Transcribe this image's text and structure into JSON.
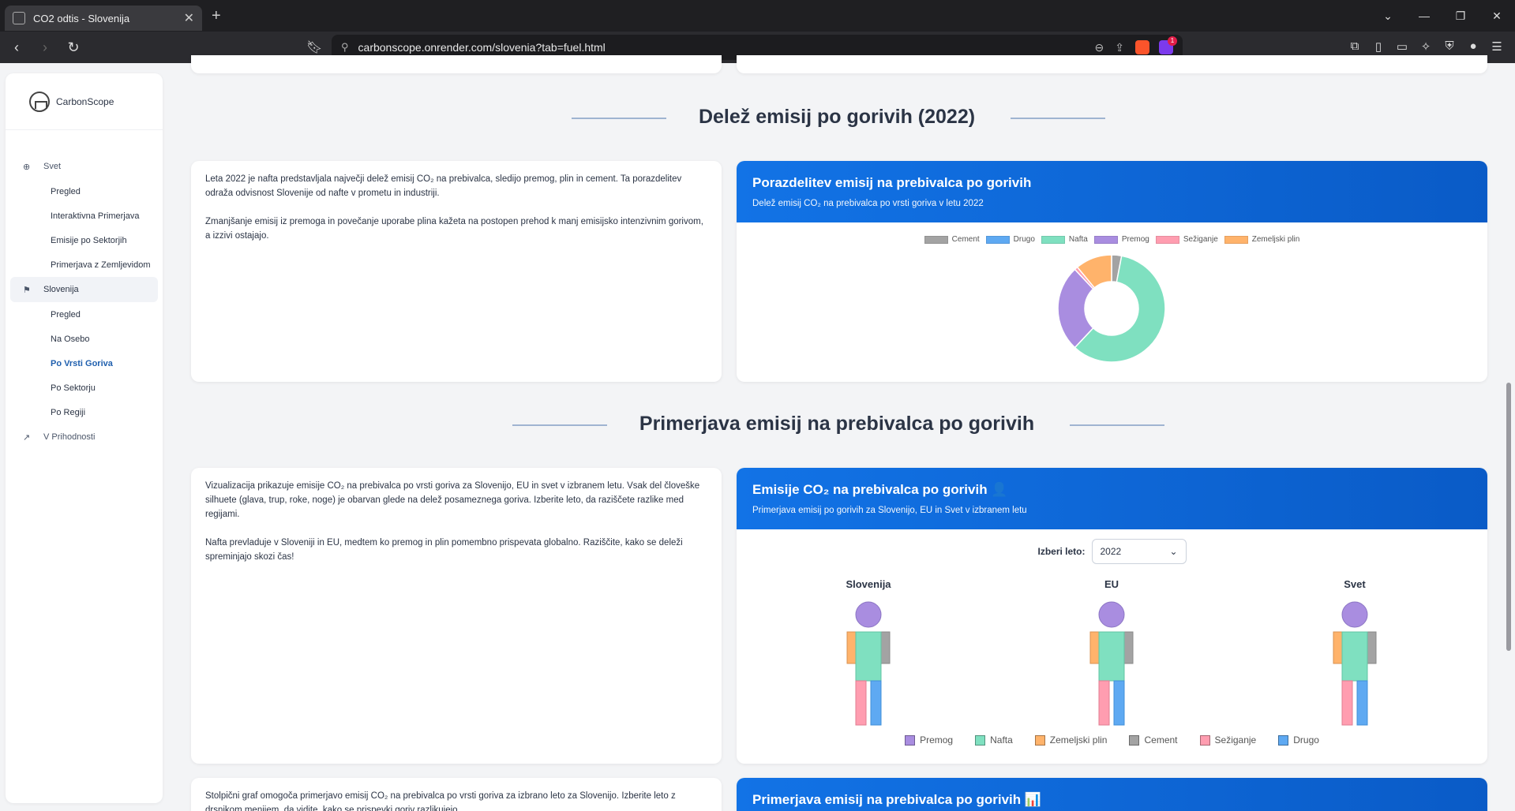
{
  "browser": {
    "tab_title": "CO2 odtis - Slovenija",
    "url": "carbonscope.onrender.com/slovenia?tab=fuel.html",
    "ext_badge": "1"
  },
  "sidebar": {
    "brand": "CarbonScope",
    "groups": [
      {
        "label": "Svet",
        "icon": "globe-icon",
        "items": [
          "Pregled",
          "Interaktivna Primerjava",
          "Emisije po Sektorjih",
          "Primerjava z Zemljevidom"
        ]
      },
      {
        "label": "Slovenija",
        "icon": "map-pin-icon",
        "items": [
          "Pregled",
          "Na Osebo",
          "Po Vrsti Goriva",
          "Po Sektorju",
          "Po Regiji"
        ]
      },
      {
        "label": "V Prihodnosti",
        "icon": "chart-icon",
        "items": []
      }
    ],
    "current_item": "Po Vrsti Goriva"
  },
  "section1": {
    "title": "Delež emisij po gorivih (2022)",
    "text_p1": "Leta 2022 je nafta predstavljala največji delež emisij CO₂ na prebivalca, sledijo premog, plin in cement. Ta porazdelitev odraža odvisnost Slovenije od nafte v prometu in industriji.",
    "text_p2": "Zmanjšanje emisij iz premoga in povečanje uporabe plina kažeta na postopen prehod k manj emisijsko intenzivnim gorivom, a izzivi ostajajo.",
    "panel_title": "Porazdelitev emisij na prebivalca po gorivih",
    "panel_subtitle": "Delež emisij CO₂ na prebivalca po vrsti goriva v letu 2022"
  },
  "section2": {
    "title": "Primerjava emisij na prebivalca po gorivih",
    "text_p1": "Vizualizacija prikazuje emisije CO₂ na prebivalca po vrsti goriva za Slovenijo, EU in svet v izbranem letu. Vsak del človeške silhuete (glava, trup, roke, noge) je obarvan glede na delež posameznega goriva. Izberite leto, da raziščete razlike med regijami.",
    "text_p2": "Nafta prevladuje v Sloveniji in EU, medtem ko premog in plin pomembno prispevata globalno. Raziščite, kako se deleži spreminjajo skozi čas!",
    "panel_title": "Emisije CO₂ na prebivalca po gorivih 👤",
    "panel_subtitle": "Primerjava emisij po gorivih za Slovenijo, EU in Svet v izbranem letu",
    "year_label": "Izberi leto:",
    "year_value": "2022",
    "figures": [
      "Slovenija",
      "EU",
      "Svet"
    ],
    "legend": [
      {
        "name": "Premog",
        "color": "#a98de0"
      },
      {
        "name": "Nafta",
        "color": "#7fe0c0"
      },
      {
        "name": "Zemeljski plin",
        "color": "#ffb36b"
      },
      {
        "name": "Cement",
        "color": "#a3a3a3"
      },
      {
        "name": "Sežiganje",
        "color": "#ff9db0"
      },
      {
        "name": "Drugo",
        "color": "#5ea9f2"
      }
    ]
  },
  "section3": {
    "text_p1": "Stolpični graf omogoča primerjavo emisij CO₂ na prebivalca po vrsti goriva za izbrano leto za Slovenijo. Izberite leto z",
    "text_p2": "drsnikom menijem, da vidite, kako se prispevki goriv razlikujejo.",
    "panel_title": "Primerjava emisij na prebivalca po gorivih 📊"
  },
  "chart_data": {
    "type": "pie",
    "title": "Porazdelitev emisij na prebivalca po gorivih",
    "categories": [
      "Cement",
      "Drugo",
      "Nafta",
      "Premog",
      "Sežiganje",
      "Zemeljski plin"
    ],
    "values": [
      3,
      0,
      59,
      26,
      1,
      11
    ],
    "colors": [
      "#a3a3a3",
      "#5ea9f2",
      "#7fe0c0",
      "#a98de0",
      "#ff9db0",
      "#ffb36b"
    ],
    "legend": "top"
  }
}
